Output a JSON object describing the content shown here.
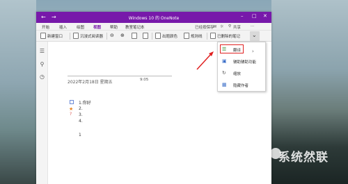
{
  "window": {
    "title": "Windows 10 的 OneNote",
    "back_glyph": "←",
    "forward_glyph": "→",
    "minimize_glyph": "–",
    "maximize_glyph": "□",
    "close_glyph": "✕"
  },
  "ribbon_tabs": [
    "开始",
    "插入",
    "绘图",
    "视图",
    "帮助",
    "教室笔记本"
  ],
  "active_tab": "视图",
  "ribbon_right": {
    "saved_status": "已经按保存",
    "share_label": "共享",
    "more_glyph": "···"
  },
  "toolbar": {
    "new_window": "新建窗口",
    "immersive_reader": "沉浸式阅读器",
    "page_color": "出题颜色",
    "rule_lines": "规则线",
    "deleted_notes": "已删除的笔记",
    "chevron": "⌄"
  },
  "page": {
    "date": "2022年2月18日 星期五",
    "time": "9:05",
    "list_items": [
      "1.你好",
      "2.",
      "3.",
      "4."
    ],
    "extra_line": "1"
  },
  "dropdown_menu": {
    "items": [
      {
        "label": "翻译",
        "icon": "translate-icon",
        "has_submenu": true
      },
      {
        "label": "辅助辅助功能",
        "icon": "accessibility-icon",
        "has_submenu": false
      },
      {
        "label": "缩放",
        "icon": "zoom-icon",
        "has_submenu": false
      },
      {
        "label": "隐藏作者",
        "icon": "hide-authors-icon",
        "has_submenu": false
      }
    ],
    "submenu_glyph": "›"
  },
  "watermark": {
    "text": "系统然联"
  },
  "colors": {
    "title_bar": "#7719aa",
    "highlight": "#e02020"
  }
}
